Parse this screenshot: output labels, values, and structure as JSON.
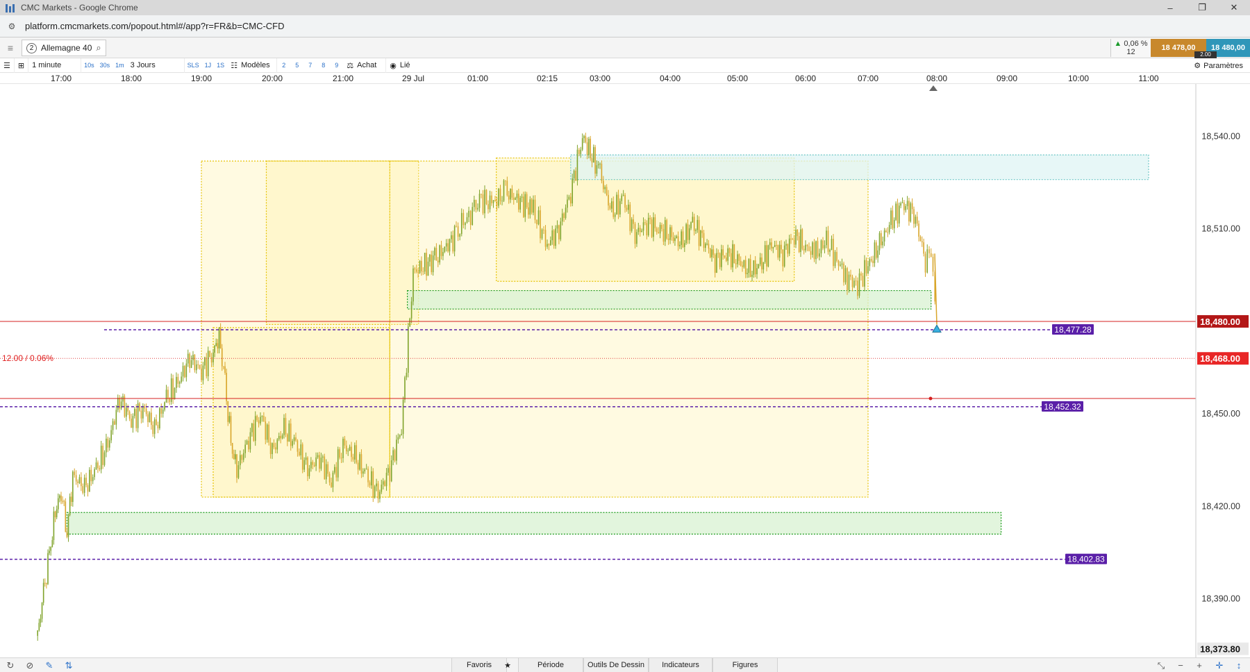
{
  "window": {
    "title": "CMC Markets - Google Chrome",
    "controls": [
      "–",
      "❐",
      "✕"
    ]
  },
  "address_bar": {
    "url": "platform.cmcmarkets.com/popout.html#/app?r=FR&b=CMC-CFD"
  },
  "instrument": {
    "number": "2",
    "name": "Allemagne 40"
  },
  "quote": {
    "change_pct": "0,06 %",
    "change_points": "12",
    "sell": "18 478,00",
    "buy": "18 480,00",
    "spread": "2.00"
  },
  "toolbar": {
    "interval": "1 minute",
    "periods": [
      "10s",
      "30s",
      "1m"
    ],
    "range": "3 Jours",
    "modes": [
      "SLS",
      "1J",
      "1S"
    ],
    "models_label": "Modèles",
    "quick_models": [
      "2",
      "5",
      "7",
      "8",
      "9"
    ],
    "buy_label": "Achat",
    "linked_label": "Lié",
    "settings_label": "Paramètres"
  },
  "time_axis": [
    "17:00",
    "18:00",
    "19:00",
    "20:00",
    "21:00",
    "29 Jul",
    "01:00",
    "02:15",
    "03:00",
    "04:00",
    "05:00",
    "06:00",
    "07:00",
    "08:00",
    "09:00",
    "10:00",
    "11:00"
  ],
  "bottom_bar": {
    "tabs": [
      "Favoris",
      "Période",
      "Outils De Dessin",
      "Indicateurs",
      "Figures"
    ]
  },
  "chart_data": {
    "type": "line",
    "title": "",
    "instrument": "Allemagne 40",
    "interval": "1 minute",
    "y_axis_ticks": [
      18540,
      18510,
      18450,
      18420,
      18390
    ],
    "y_axis_tick_labels": [
      "18,540.00",
      "18,510.00",
      "18,450.00",
      "18,420.00",
      "18,390.00"
    ],
    "ylim": [
      18371,
      18557
    ],
    "x_ticks": [
      "17:00",
      "18:00",
      "19:00",
      "20:00",
      "21:00",
      "29 Jul",
      "01:00",
      "02:15",
      "03:00",
      "04:00",
      "05:00",
      "06:00",
      "07:00",
      "08:00",
      "09:00",
      "10:00",
      "11:00"
    ],
    "series": [
      {
        "x": [
          "16:40",
          "16:45",
          "16:50",
          "16:55",
          "17:00",
          "17:05",
          "17:10",
          "17:20",
          "17:30",
          "17:40",
          "17:50",
          "18:00",
          "18:10",
          "18:20",
          "18:30",
          "18:40",
          "18:50",
          "19:00",
          "19:10",
          "19:15",
          "19:20",
          "19:25",
          "19:30",
          "19:40",
          "19:50",
          "20:00",
          "20:10",
          "20:20",
          "20:30",
          "20:40",
          "20:50",
          "21:00",
          "21:10",
          "21:20",
          "21:30",
          "21:40",
          "21:50",
          "22:00",
          "23:00",
          "00:00",
          "00:20",
          "00:40",
          "01:00",
          "01:15",
          "01:30",
          "02:00",
          "02:15",
          "02:25",
          "02:35",
          "02:45",
          "03:00",
          "03:10",
          "03:20",
          "03:30",
          "03:40",
          "03:50",
          "04:00",
          "04:10",
          "04:20",
          "04:30",
          "04:40",
          "04:50",
          "05:00",
          "05:10",
          "05:20",
          "05:30",
          "05:40",
          "05:50",
          "06:00",
          "06:10",
          "06:20",
          "06:30",
          "06:40",
          "06:50",
          "07:00",
          "07:10",
          "07:20",
          "07:30",
          "07:40",
          "07:50",
          "07:55",
          "08:00"
        ],
        "values": [
          18378,
          18392,
          18404,
          18418,
          18425,
          18412,
          18430,
          18426,
          18432,
          18440,
          18455,
          18448,
          18452,
          18445,
          18455,
          18460,
          18468,
          18464,
          18470,
          18475,
          18460,
          18440,
          18432,
          18442,
          18450,
          18438,
          18445,
          18440,
          18432,
          18436,
          18428,
          18440,
          18436,
          18430,
          18424,
          18432,
          18446,
          18496,
          18500,
          18508,
          18512,
          18515,
          18520,
          18518,
          18522,
          18516,
          18505,
          18510,
          18522,
          18540,
          18528,
          18515,
          18520,
          18508,
          18512,
          18510,
          18508,
          18505,
          18512,
          18506,
          18500,
          18502,
          18500,
          18496,
          18498,
          18505,
          18502,
          18508,
          18504,
          18502,
          18506,
          18500,
          18494,
          18492,
          18498,
          18505,
          18512,
          18518,
          18515,
          18500,
          18502,
          18479
        ]
      }
    ],
    "horizontal_lines": [
      {
        "label": "18,480.00",
        "value": 18480.0,
        "style": "solid",
        "color": "#d42020"
      },
      {
        "label": "18,477.28",
        "value": 18477.28,
        "style": "dashed",
        "color": "#5a1fa8"
      },
      {
        "label": "18,468.00",
        "value": 18468.0,
        "style": "dotted",
        "color": "#e04040"
      },
      {
        "label": "18,452.32",
        "value": 18452.32,
        "style": "dashed",
        "color": "#5a1fa8"
      },
      {
        "label": "18,402.83",
        "value": 18402.83,
        "style": "dashed",
        "color": "#5a1fa8"
      },
      {
        "label": "18,373.80",
        "value": 18373.8,
        "style": "none",
        "color": "#333333"
      }
    ],
    "unlabeled_line_value": 18455,
    "annotation": "12.00 / 0.06%",
    "zones": [
      {
        "type": "yellow",
        "x_from": "19:00",
        "x_to": "21:40",
        "y_from": 18423,
        "y_to": 18532
      },
      {
        "type": "yellow",
        "x_from": "19:55",
        "x_to": "22:15",
        "y_from": 18479,
        "y_to": 18532
      },
      {
        "type": "yellow",
        "x_from": "19:10",
        "x_to": "21:40",
        "y_from": 18423,
        "y_to": 18478
      },
      {
        "type": "yellow",
        "x_from": "21:40",
        "x_to": "07:00",
        "y_from": 18423,
        "y_to": 18532
      },
      {
        "type": "yellow",
        "x_from": "01:20",
        "x_to": "05:50",
        "y_from": 18493,
        "y_to": 18533
      },
      {
        "type": "green",
        "x_from": "21:55",
        "x_to": "07:55",
        "y_from": 18484,
        "y_to": 18490
      },
      {
        "type": "green",
        "x_from": "17:05",
        "x_to": "08:55",
        "y_from": 18411,
        "y_to": 18418
      },
      {
        "type": "cyan",
        "x_from": "02:35",
        "x_to": "11:00",
        "y_from": 18526,
        "y_to": 18534
      }
    ],
    "grid": false,
    "colors": {
      "candle_up": "#7fa32a",
      "candle_down": "#d8a52a",
      "price_tag_bg": "#b31717",
      "level_tag_bg": "#5a1fa8",
      "zone_yellow": "#fff2a8",
      "zone_green": "#d8f2d2",
      "zone_cyan": "#dff4f4"
    }
  }
}
